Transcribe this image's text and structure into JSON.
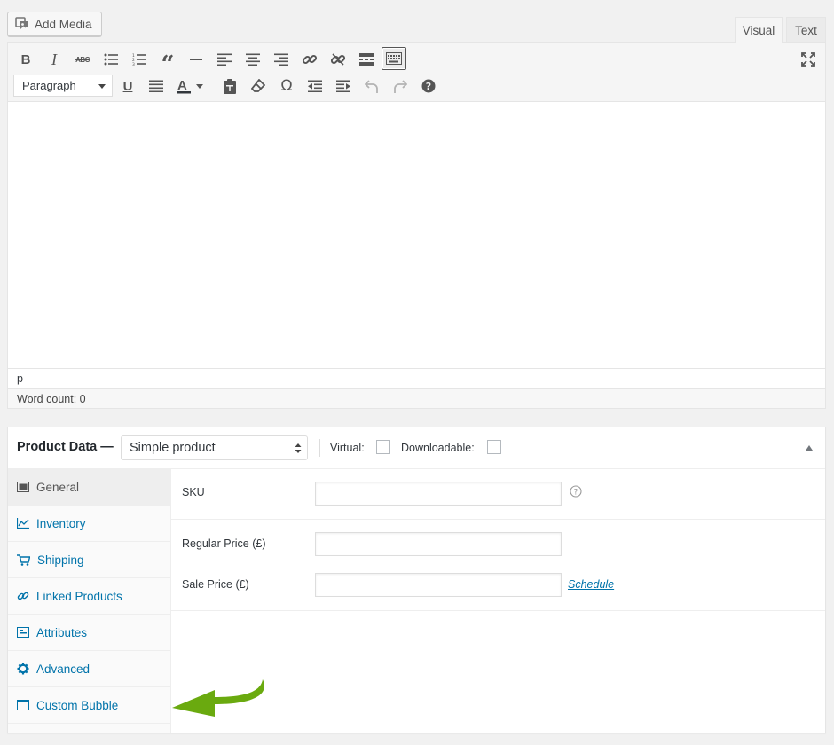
{
  "media": {
    "add_media_label": "Add Media"
  },
  "editor": {
    "tabs": {
      "visual": "Visual",
      "text": "Text"
    },
    "toolbar": {
      "row1": [
        "bold-icon",
        "italic-icon",
        "strikethrough-icon",
        "bulleted-list-icon",
        "numbered-list-icon",
        "blockquote-icon",
        "horizontal-line-icon",
        "align-left-icon",
        "align-center-icon",
        "align-right-icon",
        "link-icon",
        "unlink-icon",
        "read-more-icon",
        "toolbar-toggle-icon"
      ],
      "row2": [
        "underline-icon",
        "justify-icon",
        "text-color-icon",
        "paste-as-text-icon",
        "clear-formatting-icon",
        "special-character-icon",
        "outdent-icon",
        "indent-icon",
        "undo-icon",
        "redo-icon",
        "help-icon"
      ],
      "format_value": "Paragraph",
      "active_toggle": "toolbar-toggle-icon"
    },
    "path": "p",
    "word_count": "Word count: 0"
  },
  "product_data": {
    "title": "Product Data —",
    "type_value": "Simple product",
    "virtual_label": "Virtual:",
    "downloadable_label": "Downloadable:",
    "virtual_checked": false,
    "downloadable_checked": false,
    "tabs": [
      {
        "label": "General",
        "icon": "general-icon",
        "active": true
      },
      {
        "label": "Inventory",
        "icon": "inventory-icon",
        "active": false
      },
      {
        "label": "Shipping",
        "icon": "shipping-icon",
        "active": false
      },
      {
        "label": "Linked Products",
        "icon": "linked-products-icon",
        "active": false
      },
      {
        "label": "Attributes",
        "icon": "attributes-icon",
        "active": false
      },
      {
        "label": "Advanced",
        "icon": "advanced-icon",
        "active": false
      },
      {
        "label": "Custom Bubble",
        "icon": "custom-bubble-icon",
        "active": false
      }
    ],
    "fields": {
      "sku_label": "SKU",
      "sku_value": "",
      "regular_price_label": "Regular Price (£)",
      "regular_price_value": "",
      "sale_price_label": "Sale Price (£)",
      "sale_price_value": "",
      "schedule_link": "Schedule"
    }
  },
  "colors": {
    "link": "#0073aa",
    "arrow": "#6aaa0f",
    "page_bg": "#f1f1f1"
  }
}
